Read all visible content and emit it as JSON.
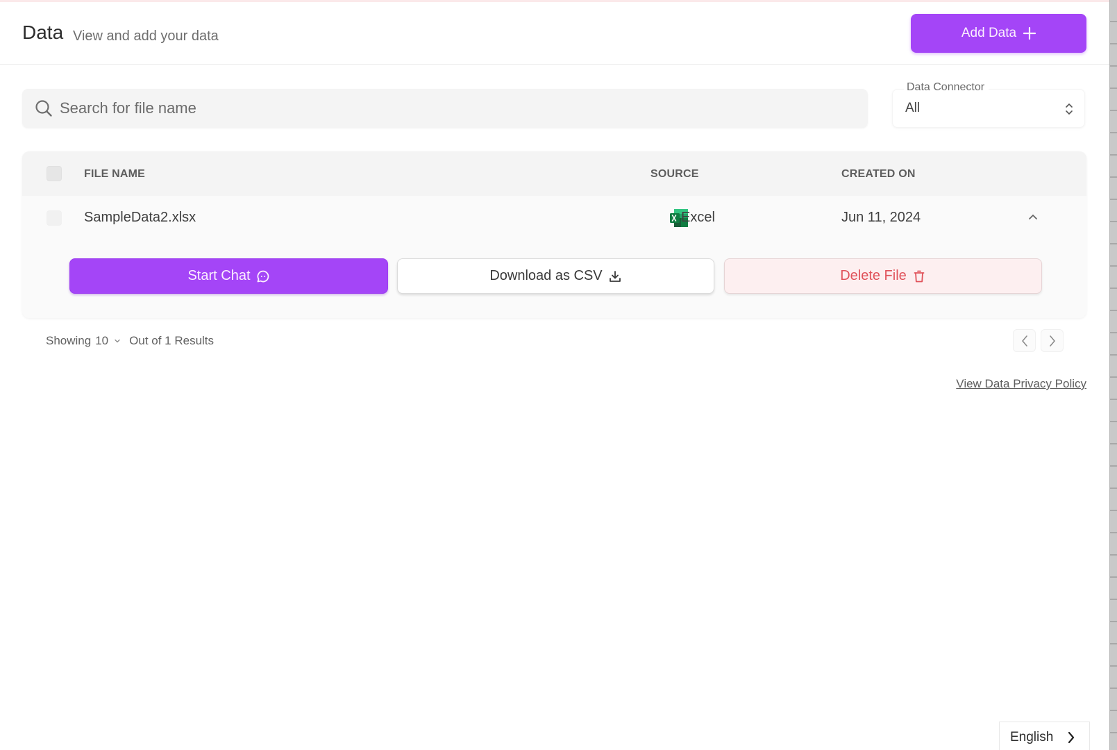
{
  "header": {
    "title": "Data",
    "subtitle": "View and add your data",
    "add_button_label": "Add Data",
    "add_button_icon": "plus-icon"
  },
  "search": {
    "placeholder": "Search for file name",
    "value": "",
    "icon": "search-icon"
  },
  "data_connector": {
    "label": "Data Connector",
    "selected": "All",
    "icon": "up-down-chevron-icon"
  },
  "table": {
    "columns": [
      "FILE NAME",
      "SOURCE",
      "CREATED ON"
    ],
    "rows": [
      {
        "file_name": "SampleData2.xlsx",
        "source": "Excel",
        "source_icon": "excel-icon",
        "created_on": "Jun 11, 2024",
        "expanded": true
      }
    ],
    "row_actions": {
      "start_chat": "Start Chat",
      "download_csv": "Download as CSV",
      "delete_file": "Delete File"
    }
  },
  "pagination": {
    "showing_label": "Showing",
    "page_size": "10",
    "results_text": "Out of 1 Results"
  },
  "footer": {
    "privacy_link": "View Data Privacy Policy",
    "language": "English"
  },
  "colors": {
    "accent": "#a445f7",
    "danger_text": "#e0525a",
    "danger_bg": "#fdeff0",
    "excel_green": "#1d7a45"
  }
}
